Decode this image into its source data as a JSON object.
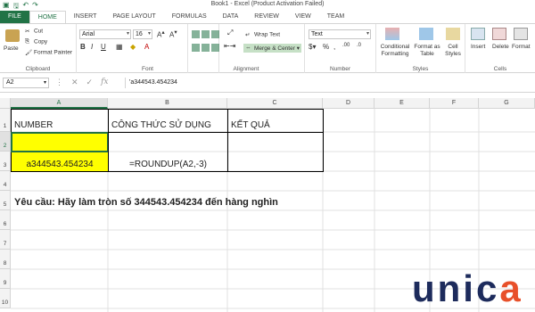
{
  "window": {
    "title": "Book1 -  Excel (Product Activation Failed)"
  },
  "tabs": [
    "FILE",
    "HOME",
    "INSERT",
    "PAGE LAYOUT",
    "FORMULAS",
    "DATA",
    "REVIEW",
    "VIEW",
    "TEAM"
  ],
  "clipboard": {
    "paste": "Paste",
    "cut": "Cut",
    "copy": "Copy",
    "format_painter": "Format Painter",
    "label": "Clipboard"
  },
  "font": {
    "name": "Arial",
    "size": "16",
    "label": "Font"
  },
  "alignment": {
    "wrap_text": "Wrap Text",
    "merge_center": "Merge & Center",
    "label": "Alignment"
  },
  "number": {
    "format": "Text",
    "label": "Number"
  },
  "styles": {
    "conditional": "Conditional Formatting",
    "format_table": "Format as Table",
    "cell_styles": "Cell Styles",
    "label": "Styles"
  },
  "cells": {
    "insert": "Insert",
    "delete": "Delete",
    "format": "Format",
    "label": "Cells"
  },
  "name_box": "A2",
  "formula": "'a344543.454234",
  "columns": [
    "A",
    "B",
    "C",
    "D",
    "E",
    "F",
    "G"
  ],
  "rows": [
    "1",
    "2",
    "3",
    "4",
    "5",
    "6",
    "7",
    "8",
    "9",
    "10"
  ],
  "cells_data": {
    "A1": "NUMBER",
    "B1": "CÔNG THỨC SỬ DỤNG",
    "C1": "KẾT QUẢ",
    "A3": "a344543.454234",
    "B3": "=ROUNDUP(A2,-3)",
    "A4": "Yêu cầu: Hãy làm tròn số 344543.454234 đến hàng nghìn"
  },
  "colors": {
    "accent": "#217346",
    "highlight": "#ffff00",
    "logo_blue": "#1d2b5c",
    "logo_orange": "#e8502a"
  },
  "logo": "unica"
}
